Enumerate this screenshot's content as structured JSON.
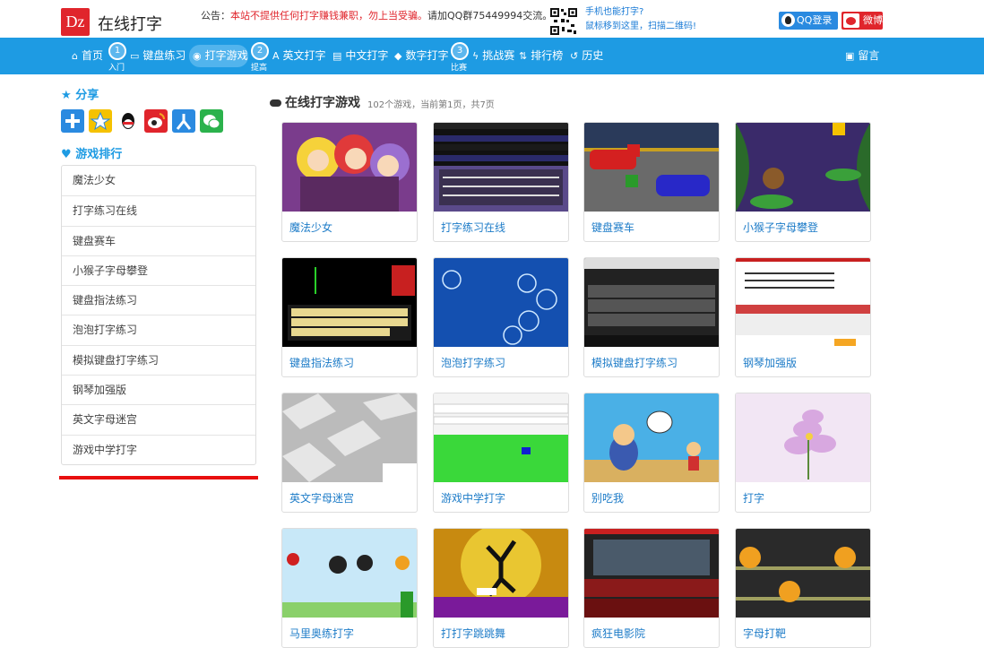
{
  "header": {
    "logo_mark": "Dz",
    "site_name": "在线打字",
    "notice_prefix": "公告：",
    "notice_red": "本站不提供任何打字赚钱兼职，勿上当受骗。",
    "notice_rest": "请加QQ群75449994交流。",
    "mobile_line1": "手机也能打字?",
    "mobile_line2": "鼠标移到这里，扫描二维码!",
    "qq_login": "QQ登录",
    "weibo_login": "微博"
  },
  "nav": {
    "items": [
      {
        "label": "首页",
        "glyph": "⌂"
      },
      {
        "label": "键盘练习",
        "glyph": "▭"
      },
      {
        "label": "打字游戏",
        "glyph": "◉"
      },
      {
        "label": "英文打字",
        "glyph": "A"
      },
      {
        "label": "中文打字",
        "glyph": "▤"
      },
      {
        "label": "数字打字",
        "glyph": "◆"
      },
      {
        "label": "挑战赛",
        "glyph": "ϟ"
      },
      {
        "label": "排行榜",
        "glyph": "⇅"
      },
      {
        "label": "历史",
        "glyph": "↺"
      },
      {
        "label": "留言",
        "glyph": "▣"
      }
    ],
    "steps": [
      {
        "num": "1",
        "label": "入门"
      },
      {
        "num": "2",
        "label": "提高"
      },
      {
        "num": "3",
        "label": "比赛"
      }
    ]
  },
  "sidebar": {
    "share_title": "分享",
    "ranking_title": "游戏排行",
    "ranking": [
      "魔法少女",
      "打字练习在线",
      "键盘赛车",
      "小猴子字母攀登",
      "键盘指法练习",
      "泡泡打字练习",
      "模拟键盘打字练习",
      "钢琴加强版",
      "英文字母迷宫",
      "游戏中学打字"
    ]
  },
  "main": {
    "title": "在线打字游戏",
    "subtitle": "102个游戏，当前第1页，共7页",
    "games": [
      "魔法少女",
      "打字练习在线",
      "键盘赛车",
      "小猴子字母攀登",
      "键盘指法练习",
      "泡泡打字练习",
      "模拟键盘打字练习",
      "钢琴加强版",
      "英文字母迷宫",
      "游戏中学打字",
      "别吃我",
      "打字",
      "马里奥练打字",
      "打打字跳跳舞",
      "疯狂电影院",
      "字母打靶"
    ]
  },
  "colors": {
    "nav_bg": "#1e9be3",
    "link": "#1e7cc8",
    "brand_red": "#e0252c"
  }
}
